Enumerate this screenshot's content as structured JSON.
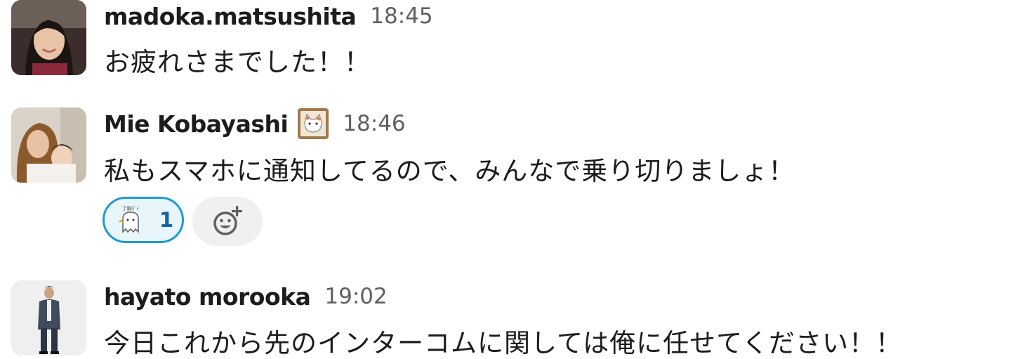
{
  "messages": [
    {
      "author": "madoka.matsushita",
      "time": "18:45",
      "text": "お疲れさまでした！！",
      "avatar_icon": "user-avatar-photo"
    },
    {
      "author": "Mie Kobayashi",
      "status_emoji_icon": "cat-status-emoji-icon",
      "time": "18:46",
      "text": "私もスマホに通知してるので、みんなで乗り切りましょ！",
      "avatar_icon": "user-avatar-photo",
      "reactions": [
        {
          "emoji_icon": "ghost-custom-emoji-icon",
          "count": "1",
          "highlighted": true
        }
      ],
      "add_reaction_icon": "add-reaction-icon"
    },
    {
      "author": "hayato morooka",
      "time": "19:02",
      "text": "今日これから先のインターコムに関しては俺に任せてください！！",
      "avatar_icon": "user-avatar-photo"
    }
  ],
  "colors": {
    "text": "#1d1c1d",
    "timestamp": "#616061",
    "reaction_border": "#1d9bd1",
    "reaction_bg": "#e8f5fa",
    "reaction_count": "#1264a3",
    "add_reaction_bg": "#f0f0f0"
  }
}
